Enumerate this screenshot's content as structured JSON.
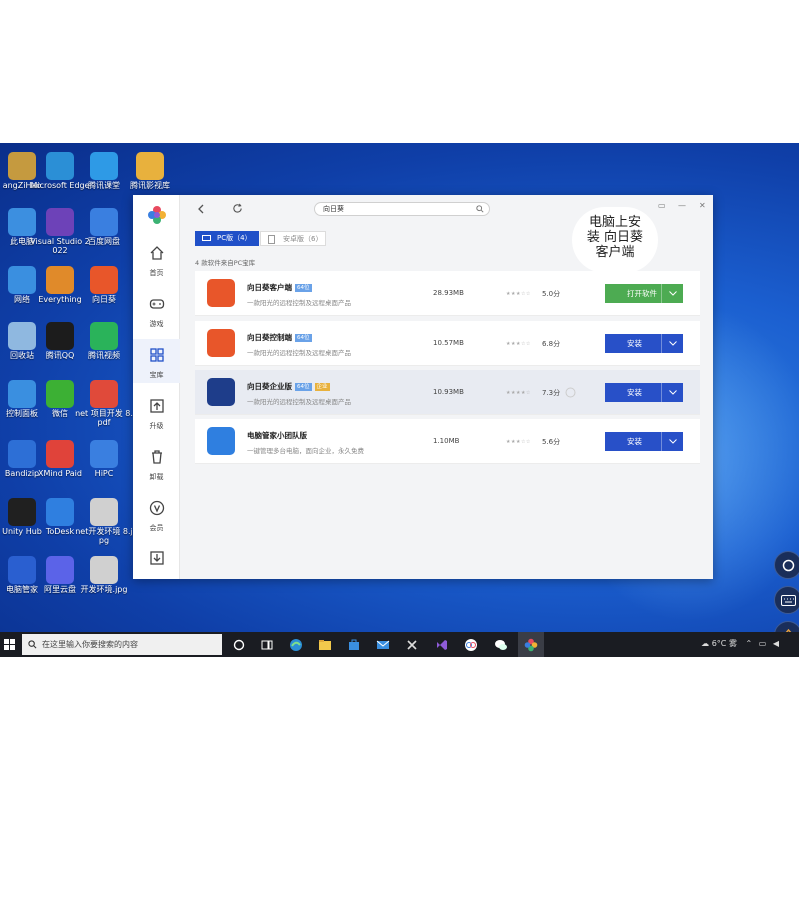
{
  "desktop_icons": [
    {
      "label": "angZiHao",
      "color": "#c59a3f"
    },
    {
      "label": "Microsoft Edge",
      "color": "#2b8fd6"
    },
    {
      "label": "腾讯课堂",
      "color": "#2e9ae6"
    },
    {
      "label": "腾讯影视库",
      "color": "#e8b13d"
    },
    {
      "label": "此电脑",
      "color": "#3c8fe0"
    },
    {
      "label": "Visual Studio 2022",
      "color": "#6d42b8"
    },
    {
      "label": "百度网盘",
      "color": "#3a7fe0"
    },
    {
      "label": "网络",
      "color": "#3a8fe0"
    },
    {
      "label": "Everything",
      "color": "#e08a2a"
    },
    {
      "label": "向日葵",
      "color": "#e8562a"
    },
    {
      "label": "回收站",
      "color": "#8fb8e0"
    },
    {
      "label": "腾讯QQ",
      "color": "#1c1c1c"
    },
    {
      "label": "腾讯视频",
      "color": "#2ab35a"
    },
    {
      "label": "控制面板",
      "color": "#3a8fe0"
    },
    {
      "label": "微信",
      "color": "#3cb034"
    },
    {
      "label": "net 项目开发 8.pdf",
      "color": "#e04a3a"
    },
    {
      "label": "Bandizip",
      "color": "#2d6fd6"
    },
    {
      "label": "XMind Paid",
      "color": "#e0433a"
    },
    {
      "label": "HiPC",
      "color": "#3a7fe0"
    },
    {
      "label": "Unity Hub",
      "color": "#202020"
    },
    {
      "label": "ToDesk",
      "color": "#2f7fe0"
    },
    {
      "label": "net开发环境 8.jpg",
      "color": "#d0d0d0"
    },
    {
      "label": "电脑管家",
      "color": "#2a5fd0"
    },
    {
      "label": "阿里云盘",
      "color": "#5b63e8"
    },
    {
      "label": "开发环境.jpg",
      "color": "#d0d0d0"
    }
  ],
  "window": {
    "search_value": "向日葵",
    "tabs": {
      "pc": "PC版（4）",
      "android": "安卓版（6）"
    },
    "count_line": "4 款软件来自PC宝库",
    "sidebar": [
      {
        "label": "首页",
        "icon": "home-icon"
      },
      {
        "label": "游戏",
        "icon": "gamepad-icon"
      },
      {
        "label": "宝库",
        "icon": "grid-icon"
      },
      {
        "label": "升级",
        "icon": "upgrade-icon"
      },
      {
        "label": "卸载",
        "icon": "trash-icon"
      },
      {
        "label": "会员",
        "icon": "vip-icon"
      },
      {
        "label": "",
        "icon": "download-icon"
      }
    ],
    "apps": [
      {
        "name": "向日葵客户端",
        "badge": "64位",
        "badge2": "",
        "desc": "一款阳光的远程控制及远程桌面产品",
        "size": "28.93MB",
        "stars": "★★★☆☆",
        "score": "5.0分",
        "button": "打开软件",
        "color": "#e8562a"
      },
      {
        "name": "向日葵控制端",
        "badge": "64位",
        "badge2": "",
        "desc": "一款阳光的远程控制及远程桌面产品",
        "size": "10.57MB",
        "stars": "★★★☆☆",
        "score": "6.8分",
        "button": "安装",
        "color": "#e8562a"
      },
      {
        "name": "向日葵企业版",
        "badge": "64位",
        "badge2": "企业",
        "desc": "一款阳光的远程控制及远程桌面产品",
        "size": "10.93MB",
        "stars": "★★★★☆",
        "score": "7.3分",
        "button": "安装",
        "color": "#1e3d8a"
      },
      {
        "name": "电脑管家小团队版",
        "badge": "",
        "badge2": "",
        "desc": "一键管理多台电脑，面向企业，永久免费",
        "size": "1.10MB",
        "stars": "★★★☆☆",
        "score": "5.6分",
        "button": "安装",
        "color": "#2f7fe0"
      }
    ]
  },
  "bubble_text": [
    "电脑上安",
    "装 向日葵",
    "客户端"
  ],
  "taskbar": {
    "search_placeholder": "在这里输入你要搜索的内容",
    "weather": "6°C 雾"
  }
}
